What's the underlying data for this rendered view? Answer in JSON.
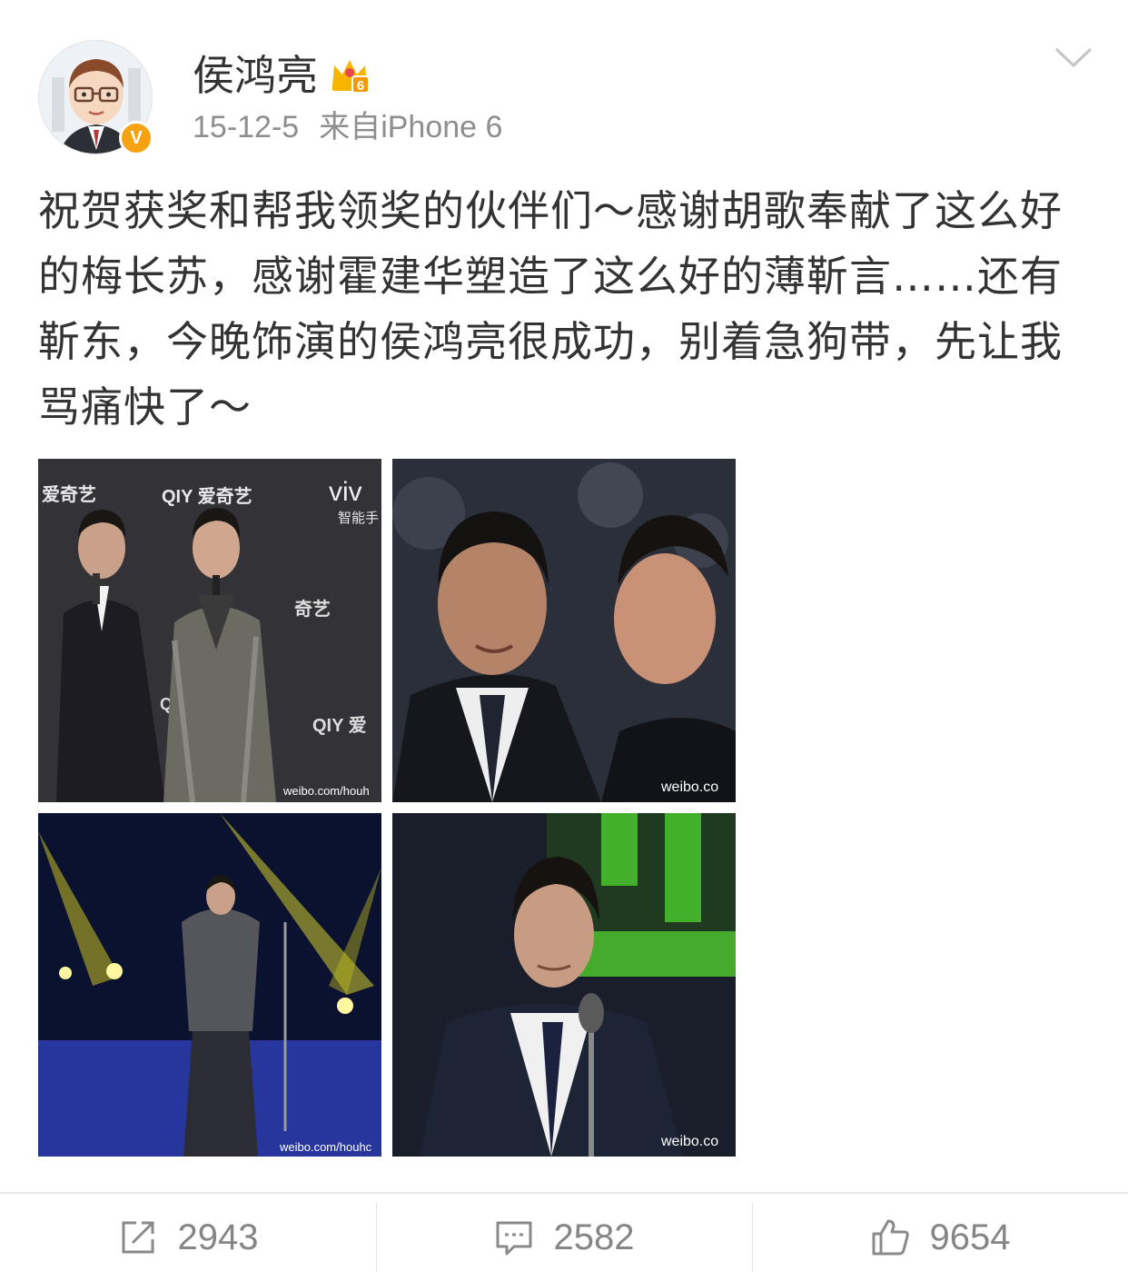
{
  "post": {
    "username": "侯鸿亮",
    "member_level": "6",
    "verified_badge": "V",
    "date": "15-12-5",
    "source": "来自iPhone 6",
    "text": "祝贺获奖和帮我领奖的伙伴们～感谢胡歌奉献了这么好的梅长苏，感谢霍建华塑造了这么好的薄靳言……还有靳东，今晚饰演的侯鸿亮很成功，别着急狗带，先让我骂痛快了～",
    "photos": [
      {
        "watermark": "weibo.com/houh",
        "overlay_texts": [
          "爱奇艺",
          "QIY 爱奇艺",
          "viv",
          "智能手",
          "奇艺",
          "QIY",
          "QIY 爱"
        ]
      },
      {
        "watermark": "weibo.co"
      },
      {
        "watermark": "weibo.com/houhc"
      },
      {
        "watermark": "weibo.co"
      }
    ]
  },
  "actions": {
    "repost_count": "2943",
    "comment_count": "2582",
    "like_count": "9654"
  },
  "colors": {
    "text": "#333333",
    "meta": "#8e8e8e",
    "verified": "#f6a313",
    "member_crown": "#f7b500"
  }
}
